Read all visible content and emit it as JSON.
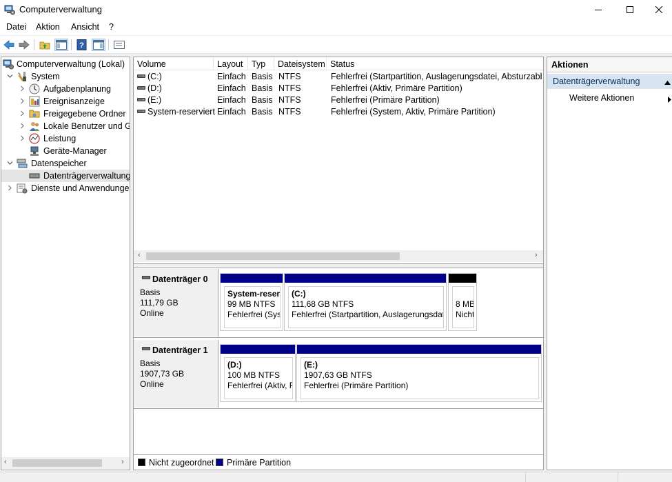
{
  "window": {
    "title": "Computerverwaltung"
  },
  "menu": [
    "Datei",
    "Aktion",
    "Ansicht",
    "?"
  ],
  "tree": [
    {
      "label": "Computerverwaltung (Lokal)",
      "indent": 0,
      "expander": "",
      "icon": "computer-management-icon"
    },
    {
      "label": "System",
      "indent": 1,
      "expander": "expanded",
      "icon": "system-tools-icon"
    },
    {
      "label": "Aufgabenplanung",
      "indent": 2,
      "expander": "collapsed",
      "icon": "task-scheduler-icon"
    },
    {
      "label": "Ereignisanzeige",
      "indent": 2,
      "expander": "collapsed",
      "icon": "event-viewer-icon"
    },
    {
      "label": "Freigegebene Ordner",
      "indent": 2,
      "expander": "collapsed",
      "icon": "shared-folders-icon"
    },
    {
      "label": "Lokale Benutzer und Gruppen",
      "indent": 2,
      "expander": "collapsed",
      "icon": "local-users-icon"
    },
    {
      "label": "Leistung",
      "indent": 2,
      "expander": "collapsed",
      "icon": "performance-icon"
    },
    {
      "label": "Geräte-Manager",
      "indent": 2,
      "expander": "",
      "icon": "device-manager-icon"
    },
    {
      "label": "Datenspeicher",
      "indent": 1,
      "expander": "expanded",
      "icon": "storage-icon"
    },
    {
      "label": "Datenträgerverwaltung",
      "indent": 2,
      "expander": "",
      "icon": "disk-management-icon",
      "selected": true
    },
    {
      "label": "Dienste und Anwendungen",
      "indent": 1,
      "expander": "collapsed",
      "icon": "services-icon"
    }
  ],
  "volume_table": {
    "columns": [
      "Volume",
      "Layout",
      "Typ",
      "Dateisystem",
      "Status"
    ],
    "rows": [
      [
        "(C:)",
        "Einfach",
        "Basis",
        "NTFS",
        "Fehlerfrei (Startpartition, Auslagerungsdatei, Absturzabbild"
      ],
      [
        "(D:)",
        "Einfach",
        "Basis",
        "NTFS",
        "Fehlerfrei (Aktiv, Primäre Partition)"
      ],
      [
        "(E:)",
        "Einfach",
        "Basis",
        "NTFS",
        "Fehlerfrei (Primäre Partition)"
      ],
      [
        "System-reserviert",
        "Einfach",
        "Basis",
        "NTFS",
        "Fehlerfrei (System, Aktiv, Primäre Partition)"
      ]
    ]
  },
  "disks": [
    {
      "name": "Datenträger 0",
      "type": "Basis",
      "size": "111,79 GB",
      "state": "Online",
      "partitions": [
        {
          "name": "System-reser",
          "size": "99 MB NTFS",
          "status": "Fehlerfrei (Syst",
          "kind": "primary"
        },
        {
          "name": "(C:)",
          "size": "111,68 GB NTFS",
          "status": "Fehlerfrei (Startpartition, Auslagerungsdat",
          "kind": "primary"
        },
        {
          "name": "",
          "size": "8 MB",
          "status": "Nicht",
          "kind": "unallocated"
        }
      ]
    },
    {
      "name": "Datenträger 1",
      "type": "Basis",
      "size": "1907,73 GB",
      "state": "Online",
      "partitions": [
        {
          "name": "(D:)",
          "size": "100 MB NTFS",
          "status": "Fehlerfrei (Aktiv, P",
          "kind": "primary"
        },
        {
          "name": "(E:)",
          "size": "1907,63 GB NTFS",
          "status": "Fehlerfrei (Primäre Partition)",
          "kind": "primary"
        }
      ]
    }
  ],
  "legend": {
    "unallocated": "Nicht zugeordnet",
    "primary": "Primäre Partition",
    "unallocated_color": "#000000",
    "primary_color": "#00008b"
  },
  "actions": {
    "header": "Aktionen",
    "section": "Datenträgerverwaltung",
    "more": "Weitere Aktionen"
  }
}
